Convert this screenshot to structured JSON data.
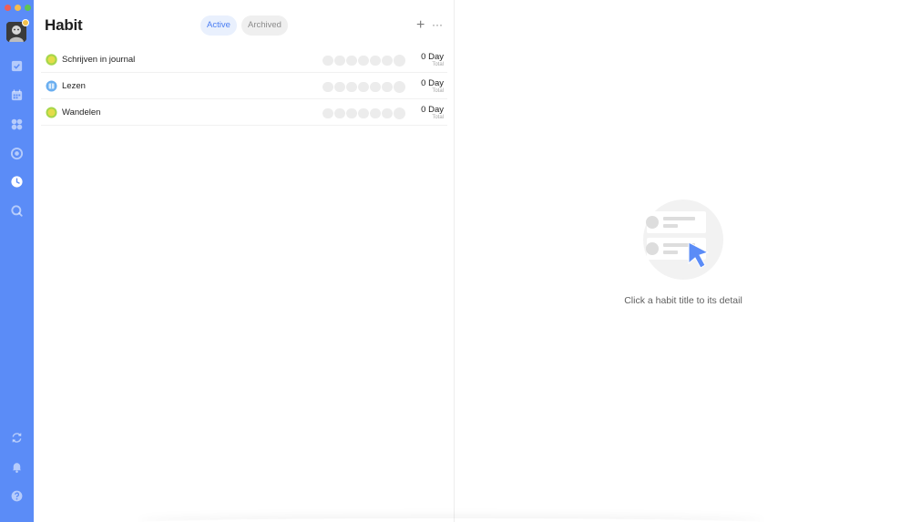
{
  "app": {
    "accent": "#5b8cf7"
  },
  "sidebar": {
    "items": [
      {
        "name": "task-icon"
      },
      {
        "name": "calendar-icon"
      },
      {
        "name": "grid-icon"
      },
      {
        "name": "focus-icon"
      },
      {
        "name": "habit-clock-icon",
        "active": true
      },
      {
        "name": "search-icon"
      },
      {
        "name": "sync-icon"
      },
      {
        "name": "bell-icon"
      },
      {
        "name": "help-icon"
      }
    ]
  },
  "list": {
    "title": "Habit",
    "tabs": {
      "active": "Active",
      "archived": "Archived"
    },
    "add_label": "+",
    "more_label": "···",
    "habits": [
      {
        "name": "Schrijven in journal",
        "icon": "lime-circle-icon",
        "icon_color": "#a5d64a",
        "streak": "0 Day",
        "streak_label": "Total"
      },
      {
        "name": "Lezen",
        "icon": "book-icon",
        "icon_color": "#6aaef0",
        "streak": "0 Day",
        "streak_label": "Total"
      },
      {
        "name": "Wandelen",
        "icon": "lime-circle-icon",
        "icon_color": "#a5d64a",
        "streak": "0 Day",
        "streak_label": "Total"
      }
    ]
  },
  "detail": {
    "empty_text": "Click a habit title to its detail"
  }
}
